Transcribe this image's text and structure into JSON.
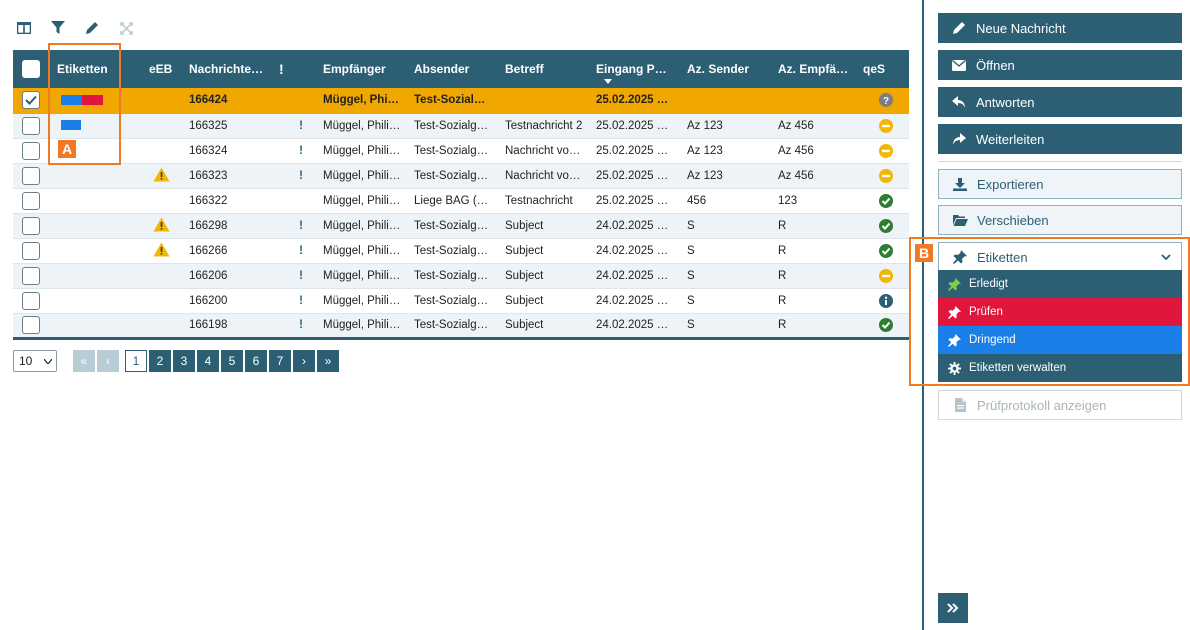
{
  "toolbar": {
    "icons": [
      "columns-icon",
      "filter-icon",
      "pencil-icon",
      "expand-icon"
    ]
  },
  "table": {
    "headers": [
      "Etiketten",
      "eEB",
      "Nachrichte…",
      "!",
      "Empfänger",
      "Absender",
      "Betreff",
      "Eingang P…",
      "Az. Sender",
      "Az. Empfä…",
      "qeS"
    ],
    "rows": [
      {
        "tags": [
          "#1a7fe8",
          "#e0163c"
        ],
        "eeb": "",
        "nr": "166424",
        "prio": "",
        "empf": "Müggel, Phi…",
        "abs": "Test-Sozial…",
        "betreff": "",
        "eingang": "25.02.2025 …",
        "azs": "",
        "aze": "",
        "qes": "question",
        "selected": true
      },
      {
        "tags": [
          "#1a7fe8"
        ],
        "eeb": "",
        "nr": "166325",
        "prio": "!",
        "empf": "Müggel, Phili…",
        "abs": "Test-Sozialg…",
        "betreff": "Testnachricht 2",
        "eingang": "25.02.2025 …",
        "azs": "Az 123",
        "aze": "Az 456",
        "qes": "minus"
      },
      {
        "tags": [],
        "eeb": "",
        "nr": "166324",
        "prio": "!",
        "empf": "Müggel, Phili…",
        "abs": "Test-Sozialg…",
        "betreff": "Nachricht vo…",
        "eingang": "25.02.2025 …",
        "azs": "Az 123",
        "aze": "Az 456",
        "qes": "minus"
      },
      {
        "tags": [],
        "eeb": "warn",
        "nr": "166323",
        "prio": "!",
        "empf": "Müggel, Phili…",
        "abs": "Test-Sozialg…",
        "betreff": "Nachricht vo…",
        "eingang": "25.02.2025 …",
        "azs": "Az 123",
        "aze": "Az 456",
        "qes": "minus"
      },
      {
        "tags": [],
        "eeb": "",
        "nr": "166322",
        "prio": "",
        "empf": "Müggel, Phili…",
        "abs": "Liege BAG (…",
        "betreff": "Testnachricht",
        "eingang": "25.02.2025 …",
        "azs": "456",
        "aze": "123",
        "qes": "check"
      },
      {
        "tags": [],
        "eeb": "warn",
        "nr": "166298",
        "prio": "!",
        "empf": "Müggel, Phili…",
        "abs": "Test-Sozialg…",
        "betreff": "Subject",
        "eingang": "24.02.2025 …",
        "azs": "S",
        "aze": "R",
        "qes": "check"
      },
      {
        "tags": [],
        "eeb": "warn",
        "nr": "166266",
        "prio": "!",
        "empf": "Müggel, Phili…",
        "abs": "Test-Sozialg…",
        "betreff": "Subject",
        "eingang": "24.02.2025 …",
        "azs": "S",
        "aze": "R",
        "qes": "check"
      },
      {
        "tags": [],
        "eeb": "",
        "nr": "166206",
        "prio": "!",
        "empf": "Müggel, Phili…",
        "abs": "Test-Sozialg…",
        "betreff": "Subject",
        "eingang": "24.02.2025 …",
        "azs": "S",
        "aze": "R",
        "qes": "minus"
      },
      {
        "tags": [],
        "eeb": "",
        "nr": "166200",
        "prio": "!",
        "empf": "Müggel, Phili…",
        "abs": "Test-Sozialg…",
        "betreff": "Subject",
        "eingang": "24.02.2025 …",
        "azs": "S",
        "aze": "R",
        "qes": "info"
      },
      {
        "tags": [],
        "eeb": "",
        "nr": "166198",
        "prio": "!",
        "empf": "Müggel, Phili…",
        "abs": "Test-Sozialg…",
        "betreff": "Subject",
        "eingang": "24.02.2025 …",
        "azs": "S",
        "aze": "R",
        "qes": "check"
      }
    ]
  },
  "pager": {
    "page_size": "10",
    "pages": [
      "1",
      "2",
      "3",
      "4",
      "5",
      "6",
      "7"
    ],
    "current": "1",
    "first": "«",
    "prev": "‹",
    "next": "›",
    "last": "»"
  },
  "annotations": {
    "a": "A",
    "b": "B"
  },
  "actions": {
    "neue_nachricht": "Neue Nachricht",
    "oeffnen": "Öffnen",
    "antworten": "Antworten",
    "weiterleiten": "Weiterleiten",
    "exportieren": "Exportieren",
    "verschieben": "Verschieben",
    "etiketten": "Etiketten",
    "pruefprotokoll": "Prüfprotokoll anzeigen"
  },
  "etiketten_menu": [
    {
      "label": "Erledigt",
      "bg": "#2d5f74",
      "icon_color": "#7bd142"
    },
    {
      "label": "Prüfen",
      "bg": "#e0163c",
      "icon_color": "#ffffff"
    },
    {
      "label": "Dringend",
      "bg": "#1a7fe8",
      "icon_color": "#ffffff"
    },
    {
      "label": "Etiketten verwalten",
      "bg": "#2d5f74",
      "icon_color": "#ffffff"
    }
  ],
  "colors": {
    "primary": "#2d5f74",
    "selected_row": "#f0a800",
    "annotation": "#f07a23",
    "warning": "#f2b705",
    "success": "#2e7d32"
  }
}
